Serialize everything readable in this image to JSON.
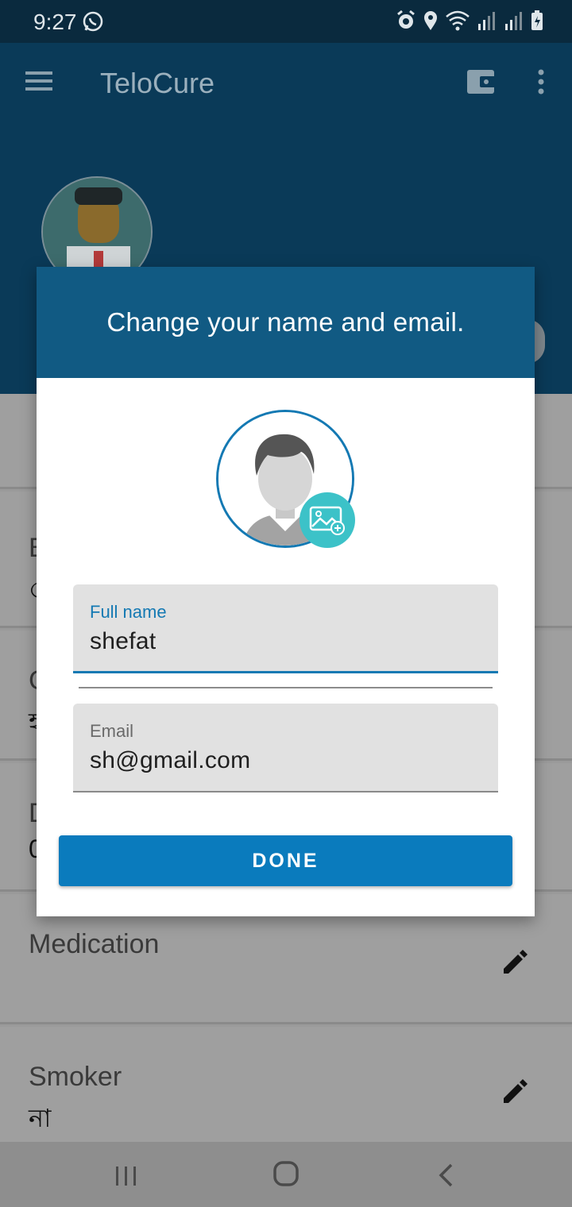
{
  "status_bar": {
    "time": "9:27",
    "left_icons": [
      "whatsapp-icon"
    ],
    "right_icons": [
      "alarm-icon",
      "location-icon",
      "wifi-icon",
      "signal-icon",
      "signal-icon",
      "battery-icon"
    ]
  },
  "app_bar": {
    "title": "TeloCure",
    "icons": [
      "menu-icon",
      "wallet-icon",
      "more-vert-icon"
    ]
  },
  "profile_list": [
    {
      "title": "B",
      "value": "৫"
    },
    {
      "title": "G",
      "value": "হ"
    },
    {
      "title": "D",
      "value": "0"
    },
    {
      "title": "Medication",
      "value": ""
    },
    {
      "title": "Smoker",
      "value": "না"
    }
  ],
  "dialog": {
    "title": "Change your name and email.",
    "avatar_icon": "default-avatar-icon",
    "photo_badge_icon": "add-photo-icon",
    "name_field": {
      "label": "Full name",
      "value": "shefat"
    },
    "email_field": {
      "label": "Email",
      "value": "sh@gmail.com"
    },
    "done_label": "DONE"
  },
  "colors": {
    "header": "#115a83",
    "accent": "#1479b3",
    "button": "#0a7bbd",
    "badge": "#3cc2c8",
    "scrim": "#9a9a9a"
  },
  "nav_bar": {
    "icons": [
      "recent-apps-icon",
      "home-icon",
      "back-icon"
    ]
  }
}
